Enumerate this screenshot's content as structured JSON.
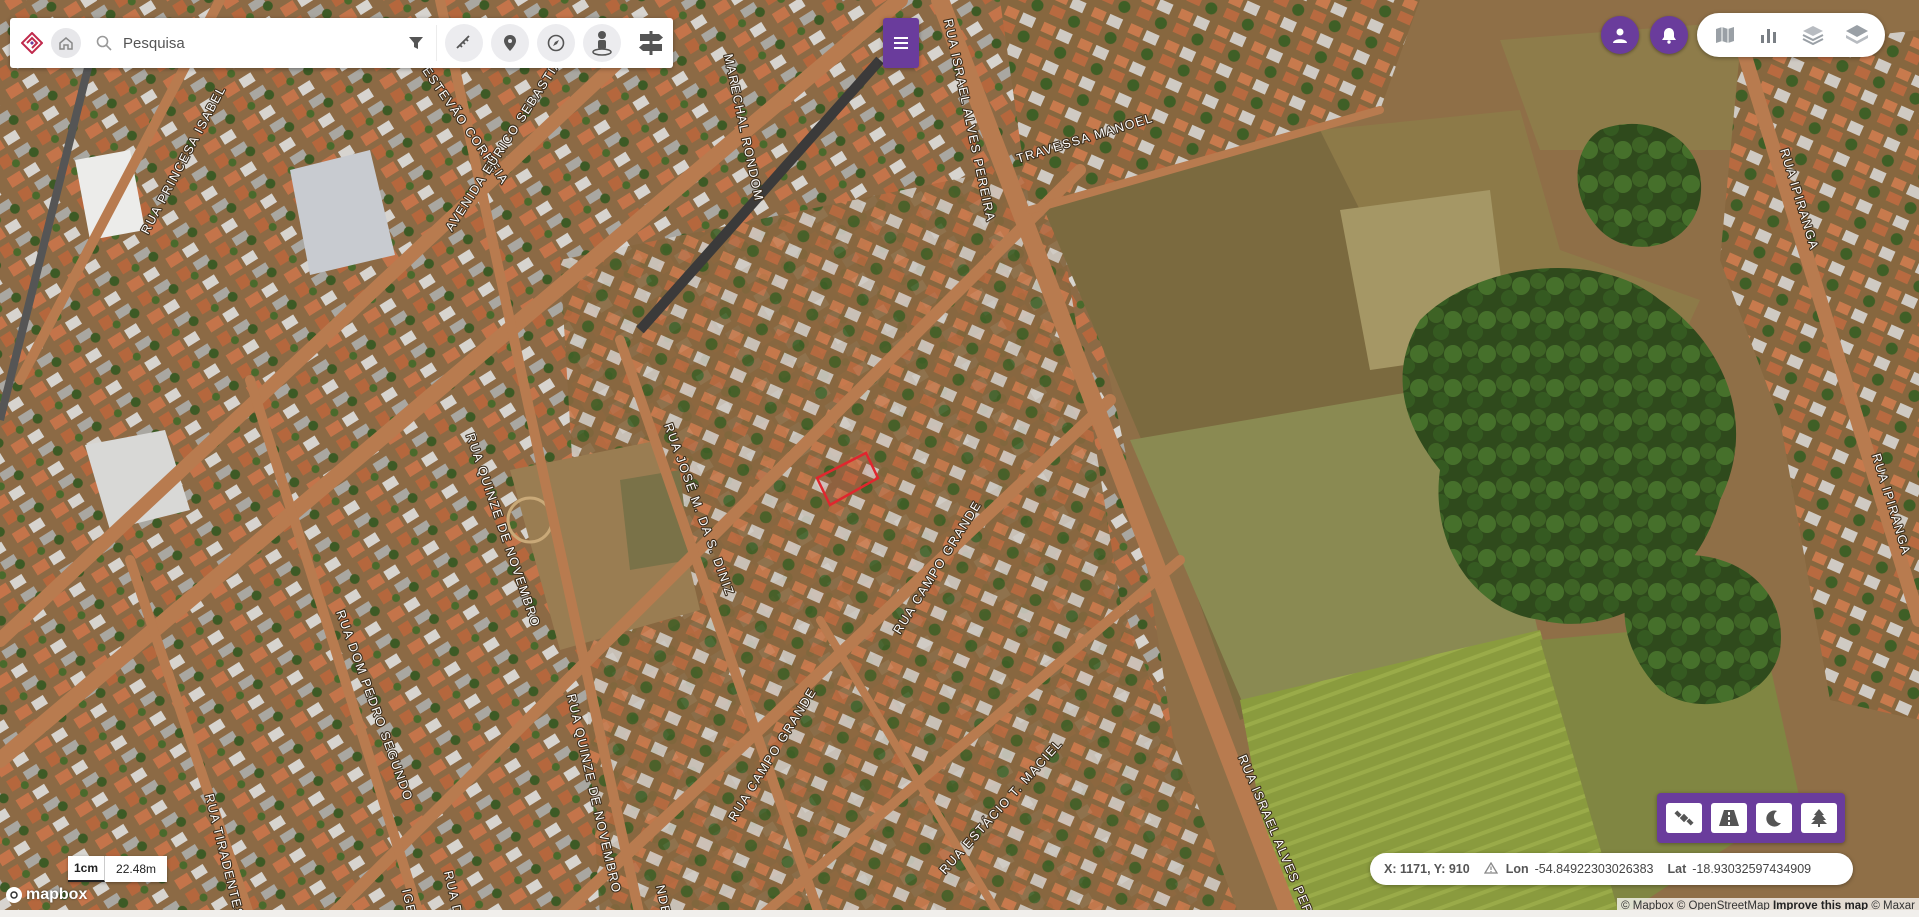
{
  "search": {
    "placeholder": "Pesquisa",
    "value": ""
  },
  "toolbar": {
    "tools": [
      "measure-icon",
      "location-pin-icon",
      "compass-icon",
      "person-marker-icon",
      "road-sign-icon"
    ],
    "menu": "hamburger-menu-icon"
  },
  "top_right": {
    "user_icon": "user-icon",
    "notification_icon": "bell-icon",
    "layers": [
      "map-icon",
      "chart-icon",
      "layers-icon",
      "stack-icon"
    ]
  },
  "map_modes": [
    "satellite-icon",
    "road-icon",
    "night-icon",
    "tree-icon"
  ],
  "streets": [
    "RUA PRINCESA ISABEL",
    "RUA ESTEVÃO CORREIA",
    "AVENIDA EURICO SEBASTIÃO",
    "MARECHAL RONDOM",
    "RUA ISRAEL ALVES PEREIRA",
    "TRAVESSA MANOEL",
    "RUA IPIRANGA",
    "RUA IPIRANGA",
    "RUA JOSÉ M. DA S. DINIZ",
    "RUA QUINZE DE NOVEMBRO",
    "RUA CAMPO GRANDE",
    "RUA DOM PEDRO SEGUNDO",
    "RUA QUINZE DE NOVEMBRO",
    "RUA CAMPO GRANDE",
    "RUA ESTÁCIO T. MACIEL",
    "RUA ISRAEL ALVES PEREIRA",
    "RUA TIRADENTES",
    "RUA D",
    "IGEL",
    "NDE"
  ],
  "scale": {
    "unit": "1cm",
    "distance": "22.48m"
  },
  "coords": {
    "xy": "X: 1171, Y: 910",
    "lon_label": "Lon",
    "lon": "-54.84922303026383",
    "lat_label": "Lat",
    "lat": "-18.93032597434909"
  },
  "attribution": {
    "mapbox": "© Mapbox",
    "osm": "© OpenStreetMap",
    "improve": "Improve this map",
    "maxar": "© Maxar"
  },
  "mapbox_logo": "mapbox",
  "colors": {
    "accent": "#6a3c9c",
    "highlight": "#e0262e"
  }
}
